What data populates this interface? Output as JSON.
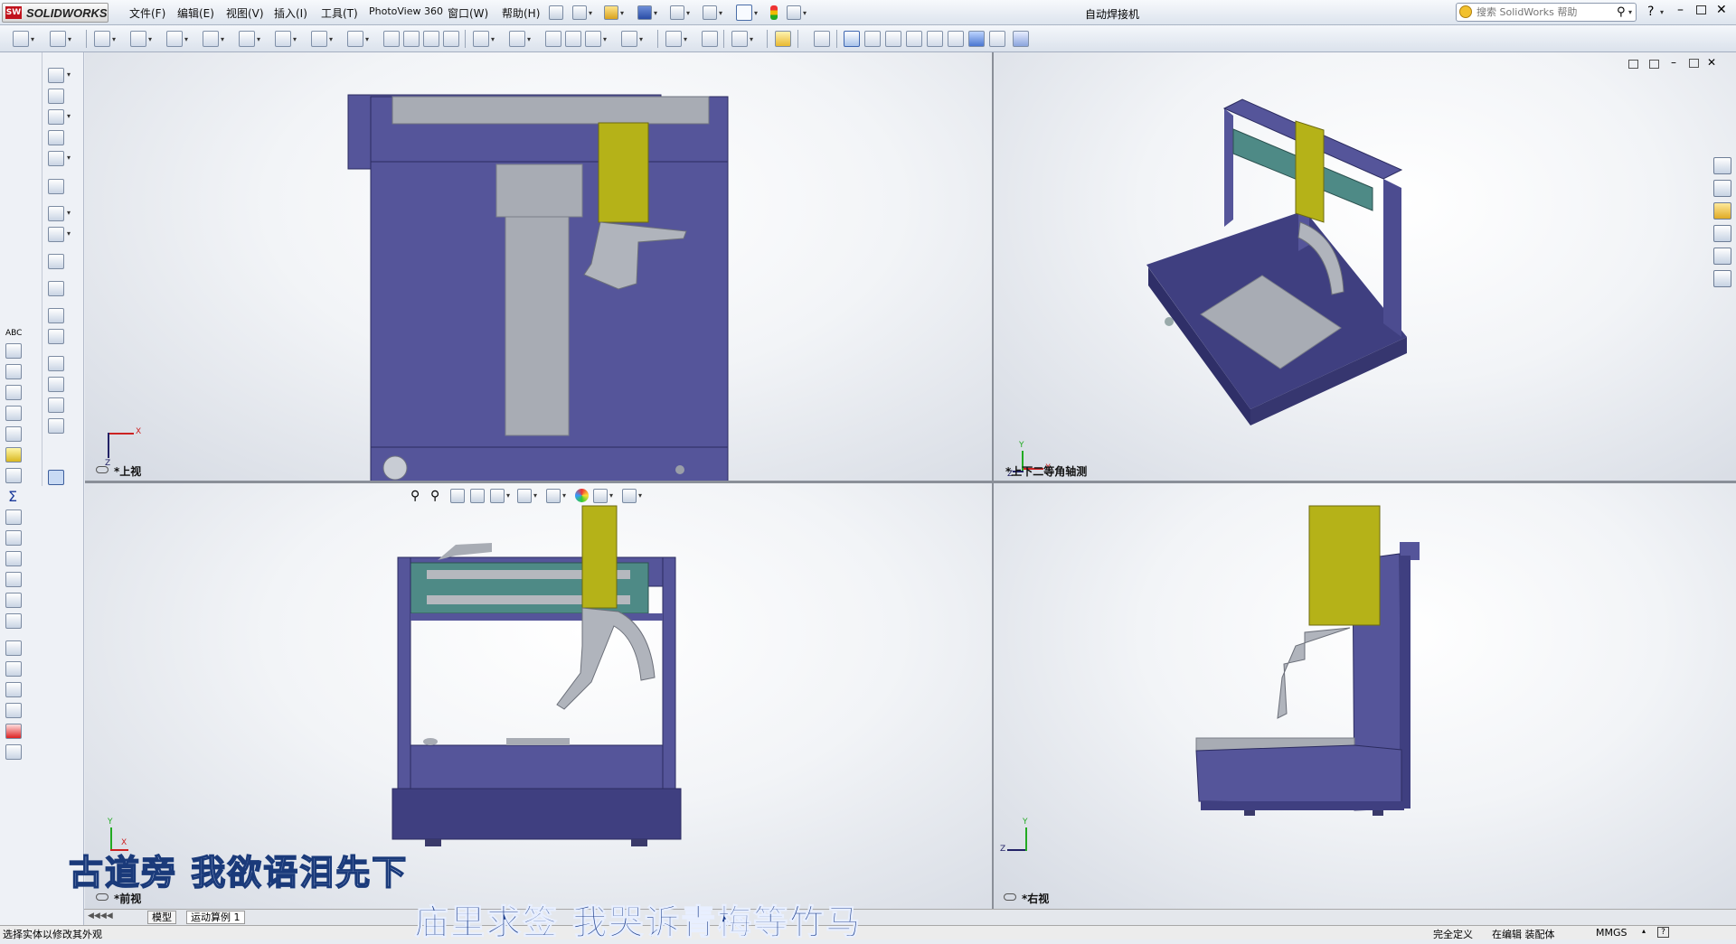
{
  "app": {
    "logo_badge": "SW",
    "logo_text": "SOLIDWORKS",
    "document_title": "自动焊接机"
  },
  "menu": [
    "文件(F)",
    "编辑(E)",
    "视图(V)",
    "插入(I)",
    "工具(T)",
    "PhotoView 360",
    "窗口(W)",
    "帮助(H)"
  ],
  "search": {
    "placeholder": "搜索 SolidWorks 帮助"
  },
  "help_button": "?",
  "viewports": {
    "top_left": {
      "label": "上视"
    },
    "top_right": {
      "label": "上下二等角轴测"
    },
    "bottom_left": {
      "label": "前视"
    },
    "bottom_right": {
      "label": "右视"
    }
  },
  "triad": {
    "x": "X",
    "y": "Y",
    "z": "Z"
  },
  "tabs": [
    "模型",
    "运动算例 1"
  ],
  "status": {
    "hint": "选择实体以修改其外观",
    "definition": "完全定义",
    "mode": "在编辑 装配体",
    "units": "MMGS"
  },
  "subtitles": {
    "line1": "古道旁  我欲语泪先下",
    "line2": "庙里求签  我哭诉青梅等竹马"
  },
  "colors": {
    "machine_blue": "#55559a",
    "machine_dark": "#3f3f80",
    "torch_yellow": "#b5b218",
    "rail_gray": "#a8acb4",
    "panel_teal": "#4e8a86"
  }
}
